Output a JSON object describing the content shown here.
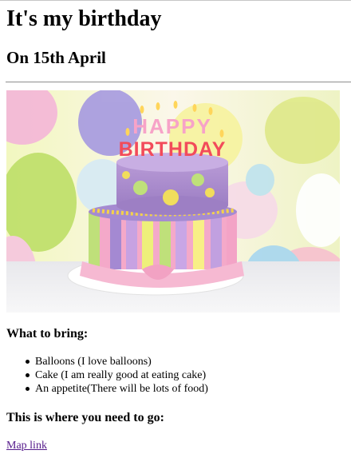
{
  "header": {
    "title": "It's my birthday",
    "date": "On 15th April"
  },
  "photo": {
    "cake_topper_line1": "HAPPY",
    "cake_topper_line2": "BIRTHDAY"
  },
  "bring": {
    "heading": "What to bring:",
    "items": [
      "Balloons (I love balloons)",
      "Cake (I am really good at eating cake)",
      "An appetite(There will be lots of food)"
    ]
  },
  "location": {
    "heading": "This is where you need to go:",
    "link_label": "Map link"
  },
  "colors": {
    "link_visited": "#551a8b",
    "rule": "#9a9a9a"
  }
}
